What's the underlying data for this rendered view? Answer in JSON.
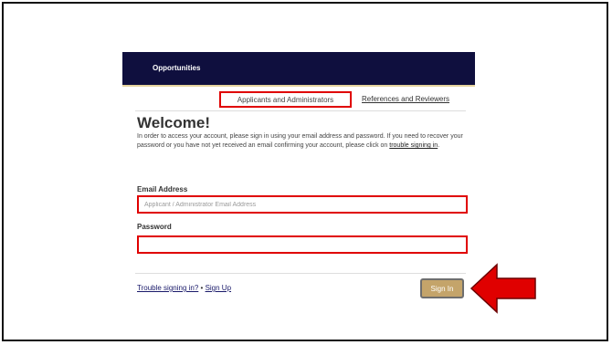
{
  "nav": {
    "opportunities": "Opportunities"
  },
  "tabs": {
    "applicants": "Applicants and Administrators",
    "references": "References and Reviewers"
  },
  "welcome": {
    "title": "Welcome!",
    "intro_prefix": "In order to access your account, please sign in using your email address and password. If you need to recover your password or you have not yet received an email confirming your account, please click on ",
    "intro_link": "trouble signing in",
    "intro_suffix": "."
  },
  "form": {
    "email_label": "Email Address",
    "email_placeholder": "Applicant / Administrator Email Address",
    "email_value": "",
    "password_label": "Password",
    "password_value": ""
  },
  "footer": {
    "trouble_link": "Trouble signing in?",
    "separator": " • ",
    "signup_link": "Sign Up",
    "signin_button": "Sign In"
  },
  "colors": {
    "navbar": "#0f0f3e",
    "highlight": "#e00000",
    "signin_button": "#c4a46a"
  },
  "icons": {
    "pointer": "red-arrow-icon"
  }
}
